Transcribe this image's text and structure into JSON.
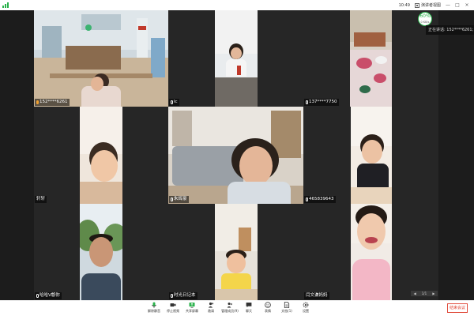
{
  "topbar": {
    "time": "10:49",
    "view_label": "演讲者视图",
    "window_controls": [
      "—",
      "□",
      "×"
    ]
  },
  "network_badge": {
    "value": "60%",
    "sub": "0 KB/s"
  },
  "speaking_indicator": "正在讲话: 152****6261;",
  "tiles": [
    {
      "id": "t1",
      "name": "152****6261",
      "mic": "on",
      "active": true
    },
    {
      "id": "t2",
      "name": "lc",
      "mic": "muted"
    },
    {
      "id": "t3",
      "name": "137****7750",
      "mic": "muted"
    },
    {
      "id": "t4",
      "name": "轩轩",
      "mic": "none"
    },
    {
      "id": "t5",
      "name": "朱辉豪",
      "mic": "muted"
    },
    {
      "id": "t6",
      "name": "465839643",
      "mic": "muted"
    },
    {
      "id": "t7",
      "name": "哈哈V憨你",
      "mic": "muted"
    },
    {
      "id": "t8",
      "name": "时光日记本",
      "mic": "muted"
    },
    {
      "id": "t9",
      "name": "闫文谦妈妈",
      "mic": "none"
    }
  ],
  "pager": {
    "prev": "◀",
    "page": "1/1",
    "next": "▶"
  },
  "toolbar": {
    "items": [
      {
        "label": "解除静音",
        "icon": "mic-icon"
      },
      {
        "label": "停止视频",
        "icon": "video-icon"
      },
      {
        "label": "共享屏幕",
        "icon": "share-screen-icon"
      },
      {
        "label": "邀请",
        "icon": "invite-icon"
      },
      {
        "label": "管理成员(9)",
        "icon": "participants-icon"
      },
      {
        "label": "聊天",
        "icon": "chat-icon"
      },
      {
        "label": "表情",
        "icon": "emoji-icon"
      },
      {
        "label": "文档(1)",
        "icon": "document-icon"
      },
      {
        "label": "设置",
        "icon": "settings-icon"
      }
    ],
    "end_label": "结束会议"
  },
  "colors": {
    "accent": "#39c54a",
    "danger": "#e04a3a",
    "muted_bg": "#262626"
  }
}
